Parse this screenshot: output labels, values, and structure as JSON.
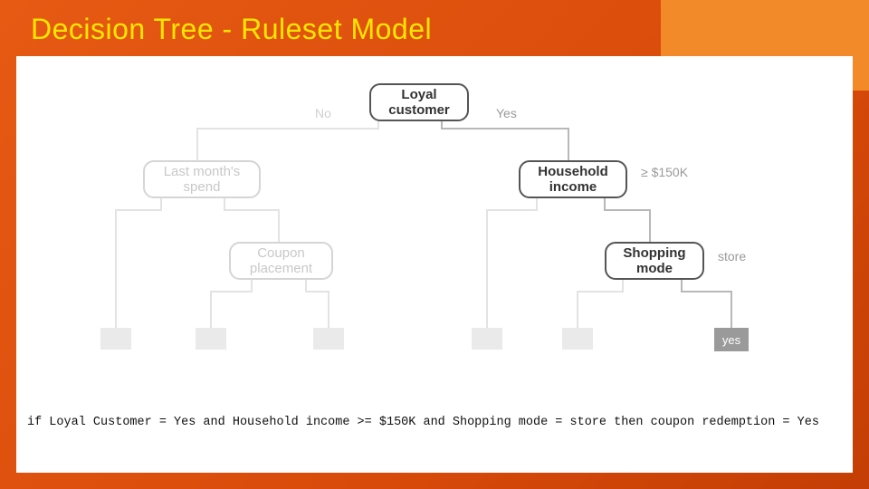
{
  "title": "Decision Tree - Ruleset Model",
  "nodes": {
    "root": "Loyal\ncustomer",
    "root_no": "No",
    "root_yes": "Yes",
    "left1": "Last month's\nspend",
    "left2": "Coupon\nplacement",
    "right1": "Household\nincome",
    "right1_lbl": "≥ $150K",
    "right2": "Shopping\nmode",
    "right2_lbl": "store",
    "leaf_yes": "yes"
  },
  "rule": "if Loyal Customer = Yes and Household income >= $150K and Shopping mode = store then coupon redemption = Yes",
  "chart_data": {
    "type": "tree",
    "root": {
      "label": "Loyal customer",
      "children": [
        {
          "edge": "No",
          "label": "Last month's spend",
          "highlighted": false,
          "children": [
            {
              "edge": null,
              "label": "(leaf)",
              "highlighted": false
            },
            {
              "edge": null,
              "label": "Coupon placement",
              "highlighted": false,
              "children": [
                {
                  "edge": null,
                  "label": "(leaf)",
                  "highlighted": false
                },
                {
                  "edge": null,
                  "label": "(leaf)",
                  "highlighted": false
                }
              ]
            }
          ]
        },
        {
          "edge": "Yes",
          "label": "Household income",
          "highlighted": true,
          "children": [
            {
              "edge": null,
              "label": "(leaf)",
              "highlighted": false
            },
            {
              "edge": "≥ $150K",
              "label": "Shopping mode",
              "highlighted": true,
              "children": [
                {
                  "edge": null,
                  "label": "(leaf)",
                  "highlighted": false
                },
                {
                  "edge": "store",
                  "label": "yes",
                  "highlighted": true
                }
              ]
            }
          ]
        }
      ]
    },
    "highlighted_rule": "if Loyal Customer = Yes and Household income >= $150K and Shopping mode = store then coupon redemption = Yes"
  }
}
